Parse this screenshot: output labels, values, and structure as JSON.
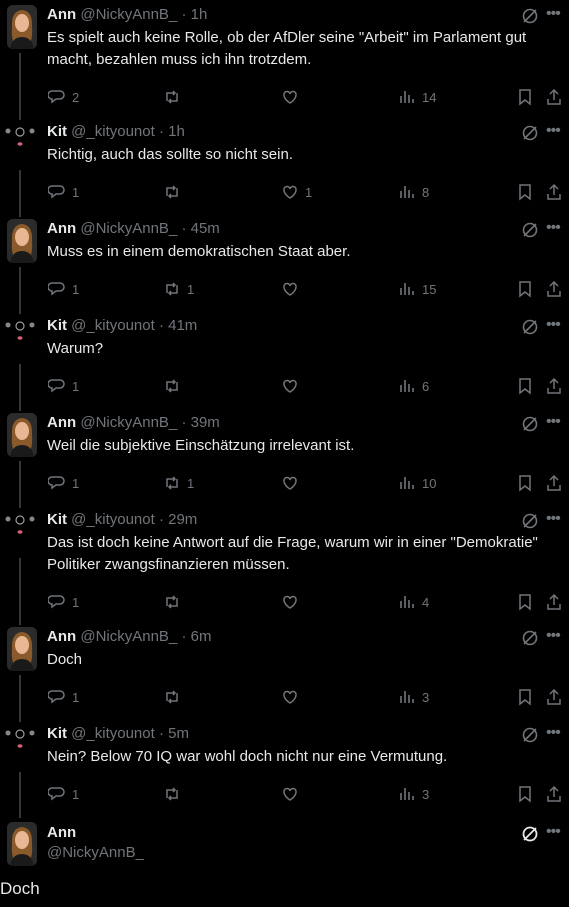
{
  "tweets": [
    {
      "author": "Ann",
      "handle": "@NickyAnnB_",
      "time": "· 1h",
      "text": "Es spielt auch keine Rolle, ob der AfDler seine \"Arbeit\" im Parlament gut macht, bezahlen muss ich ihn trotzdem.",
      "replies": "2",
      "retweets": "",
      "likes": "",
      "views": "14",
      "avatar": "ann"
    },
    {
      "author": "Kit",
      "handle": "@_kityounot",
      "time": "· 1h",
      "text": "Richtig, auch das sollte so nicht sein.",
      "replies": "1",
      "retweets": "",
      "likes": "1",
      "views": "8",
      "avatar": "kit"
    },
    {
      "author": "Ann",
      "handle": "@NickyAnnB_",
      "time": "· 45m",
      "text": "Muss es in einem demokratischen Staat aber.",
      "replies": "1",
      "retweets": "1",
      "likes": "",
      "views": "15",
      "avatar": "ann"
    },
    {
      "author": "Kit",
      "handle": "@_kityounot",
      "time": "· 41m",
      "text": "Warum?",
      "replies": "1",
      "retweets": "",
      "likes": "",
      "views": "6",
      "avatar": "kit"
    },
    {
      "author": "Ann",
      "handle": "@NickyAnnB_",
      "time": "· 39m",
      "text": "Weil die subjektive Einschätzung irrelevant ist.",
      "replies": "1",
      "retweets": "1",
      "likes": "",
      "views": "10",
      "avatar": "ann"
    },
    {
      "author": "Kit",
      "handle": "@_kityounot",
      "time": "· 29m",
      "text": "Das ist doch keine Antwort auf die Frage, warum wir in einer \"Demokratie\" Politiker zwangsfinanzieren müssen.",
      "replies": "1",
      "retweets": "",
      "likes": "",
      "views": "4",
      "avatar": "kit"
    },
    {
      "author": "Ann",
      "handle": "@NickyAnnB_",
      "time": "· 6m",
      "text": "Doch",
      "replies": "1",
      "retweets": "",
      "likes": "",
      "views": "3",
      "avatar": "ann"
    },
    {
      "author": "Kit",
      "handle": "@_kityounot",
      "time": "· 5m",
      "text": "Nein? Below 70 IQ war wohl doch nicht nur eine Vermutung.",
      "replies": "1",
      "retweets": "",
      "likes": "",
      "views": "3",
      "avatar": "kit"
    }
  ],
  "main_tweet": {
    "author": "Ann",
    "handle": "@NickyAnnB_",
    "text": "Doch"
  },
  "icons": {
    "reply": "reply-icon",
    "retweet": "retweet-icon",
    "like": "heart-icon",
    "views": "views-icon",
    "bookmark": "bookmark-icon",
    "share": "share-icon",
    "grok": "grok-icon",
    "more": "more-icon"
  },
  "colors": {
    "background": "#000000",
    "text": "#e7e9ea",
    "muted": "#71767b",
    "line": "#333639"
  }
}
